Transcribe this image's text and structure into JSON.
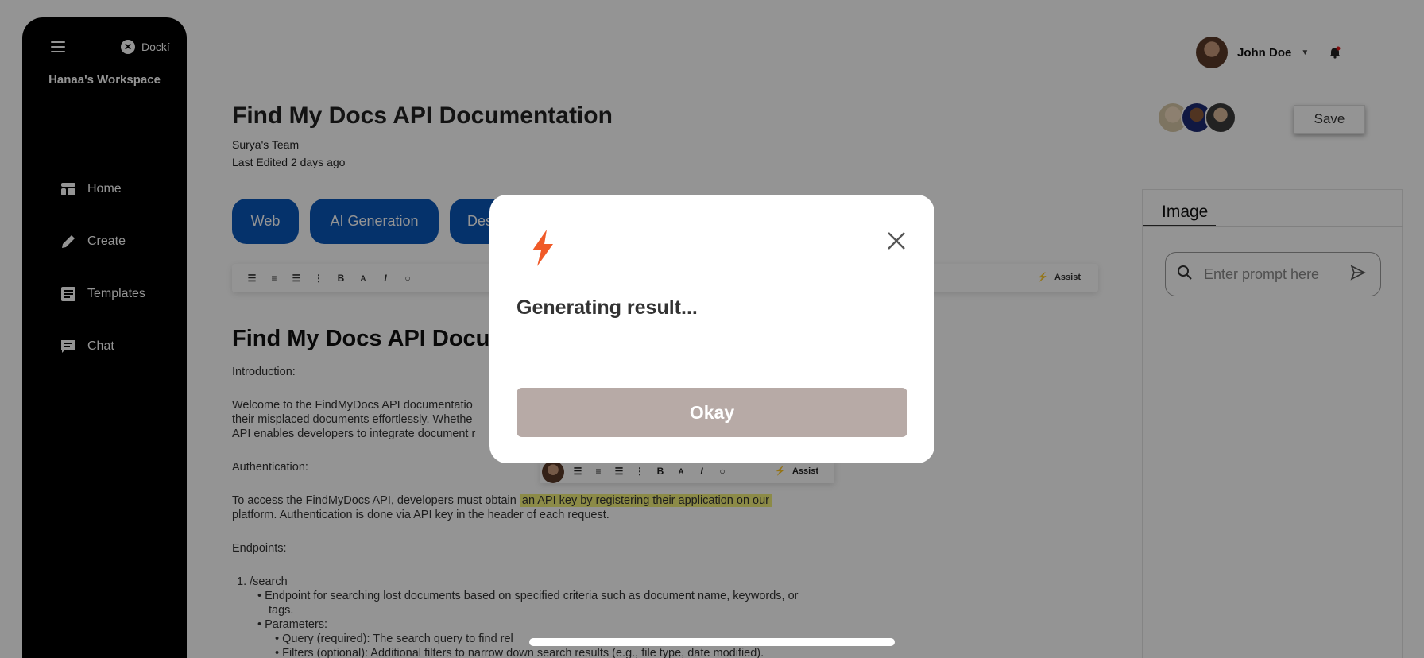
{
  "sidebar": {
    "brand": "Dockí",
    "workspace": "Hanaa's Workspace",
    "items": [
      {
        "label": "Home",
        "icon": "home-icon"
      },
      {
        "label": "Create",
        "icon": "pencil-icon"
      },
      {
        "label": "Templates",
        "icon": "templates-icon"
      },
      {
        "label": "Chat",
        "icon": "chat-icon"
      }
    ]
  },
  "header": {
    "user_name": "John Doe",
    "save_label": "Save"
  },
  "document": {
    "title": "Find My Docs API Documentation",
    "team": "Surya's Team",
    "last_edited": "Last Edited 2 days ago",
    "tabs": [
      "Web",
      "AI Generation",
      "Des"
    ],
    "assist_label": "Assist",
    "body_heading": "Find My Docs API Docu",
    "intro_label": "Introduction:",
    "intro_line1": " Welcome to the FindMyDocs API documentatio",
    "intro_line2": "their misplaced documents effortlessly. Whethe",
    "intro_line3": "API enables developers to integrate document r",
    "auth_label": "Authentication:",
    "auth_text_a": "To access the FindMyDocs API, developers must obtain ",
    "auth_highlight": "an API key by registering their application on our",
    "auth_text_b": "platform. Authentication is done via API key in the header of each request.",
    "endpoints_label": "Endpoints:",
    "ep1": "1.  /search",
    "ep1_desc1": "•  Endpoint for searching lost documents based on specified criteria such as document name, keywords, or",
    "ep1_desc2": "tags.",
    "ep1_params": "•  Parameters:",
    "ep1_query": "•  Query (required): The search query to find rel",
    "ep1_filters": "•  Filters (optional): Additional filters to narrow down search results (e.g., file type, date modified)."
  },
  "right_panel": {
    "tab": "Image",
    "prompt_placeholder": "Enter prompt here"
  },
  "modal": {
    "title": "Generating result...",
    "okay_label": "Okay"
  },
  "colors": {
    "accent_blue": "#0a56b8",
    "bolt_orange": "#f05a28",
    "okay_button": "#b7aaa6",
    "highlight": "#f1f07a"
  }
}
